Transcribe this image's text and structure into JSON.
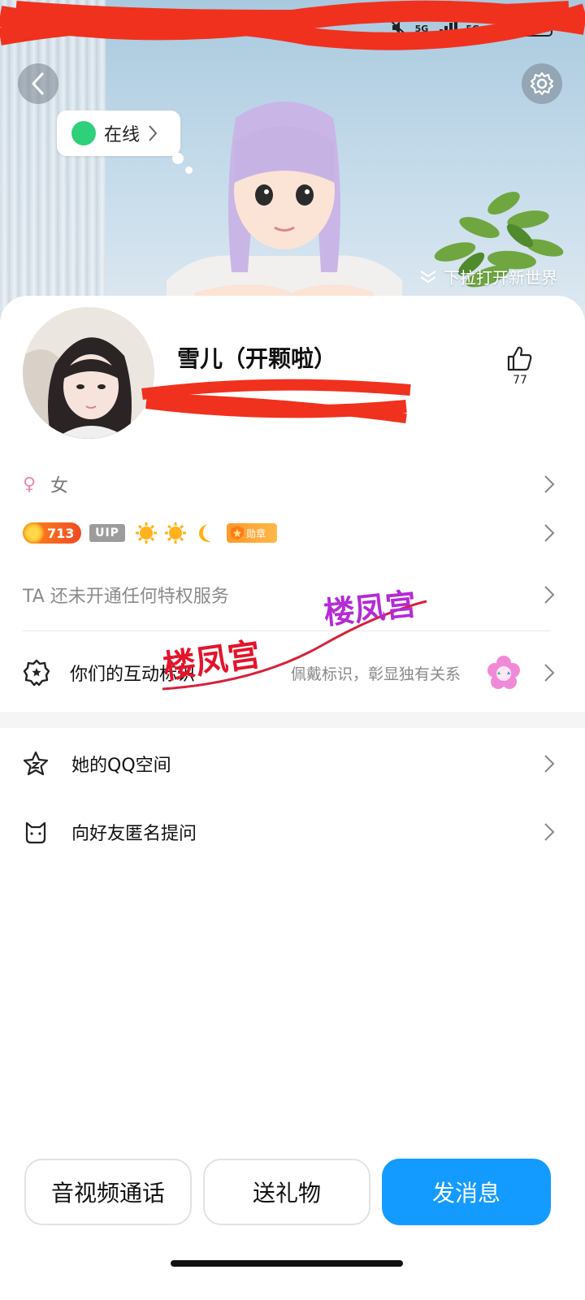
{
  "status_bar": {
    "network_1": "5G",
    "network_2": "5G",
    "battery": "48"
  },
  "hero": {
    "online_status": "在线",
    "pull_hint": "下拉打开新世界"
  },
  "profile": {
    "nickname": "雪儿（开颗啦）",
    "like_count": "77"
  },
  "info": {
    "gender_symbol": "♀",
    "gender": "女",
    "level_count": "713",
    "vip_label": "UIP",
    "medal_label": "勋章",
    "privilege_text": "TA 还未开通任何特权服务"
  },
  "interaction": {
    "label": "你们的互动标识",
    "hint": "佩戴标识，彰显独有关系"
  },
  "list": {
    "qzone_label": "她的QQ空间",
    "ask_label": "向好友匿名提问"
  },
  "watermark": {
    "text_1": "楼凤宫",
    "text_2": "楼凤宫"
  },
  "actions": {
    "call_label": "音视频通话",
    "gift_label": "送礼物",
    "message_label": "发消息"
  },
  "colors": {
    "primary_blue": "#139bff",
    "online_green": "#2ed079",
    "gender_pink": "#e58bb4",
    "level_orange": "#f04a23"
  },
  "icons": [
    "back-icon",
    "gear-icon",
    "thumbs-up-icon",
    "chevron-right-icon",
    "badge-star-icon",
    "qzone-star-icon",
    "cat-icon",
    "flower-icon"
  ]
}
